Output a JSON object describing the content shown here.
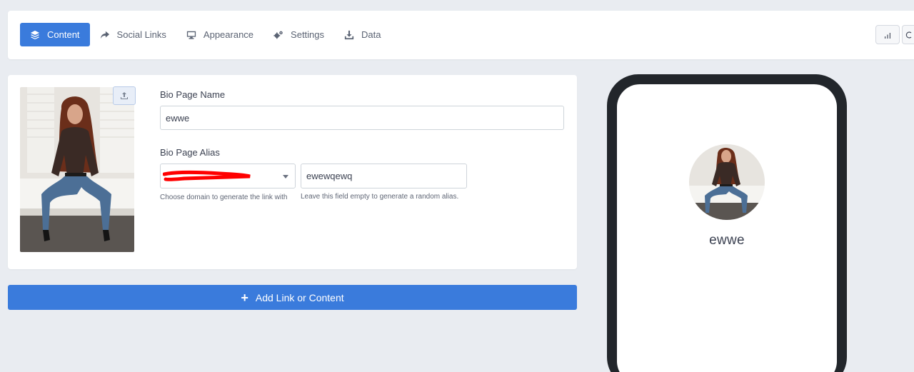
{
  "tabs": [
    {
      "label": "Content",
      "icon": "layers-icon",
      "active": true
    },
    {
      "label": "Social Links",
      "icon": "share-arrow-icon",
      "active": false
    },
    {
      "label": "Appearance",
      "icon": "monitor-icon",
      "active": false
    },
    {
      "label": "Settings",
      "icon": "gears-icon",
      "active": false
    },
    {
      "label": "Data",
      "icon": "download-icon",
      "active": false
    }
  ],
  "toolbar_right": [
    {
      "icon": "bar-chart-icon"
    },
    {
      "icon": "circle-icon"
    }
  ],
  "form": {
    "name_label": "Bio Page Name",
    "name_value": "ewwe",
    "alias_label": "Bio Page Alias",
    "domain_value": "",
    "domain_help": "Choose domain to generate the link with",
    "alias_value": "ewewqewq",
    "alias_help": "Leave this field empty to generate a random alias."
  },
  "add_button": {
    "label": "Add Link or Content"
  },
  "preview": {
    "name": "ewwe"
  },
  "colors": {
    "accent": "#3a7bdc",
    "redaction": "#ff0000",
    "phone_frame": "#22262b"
  }
}
